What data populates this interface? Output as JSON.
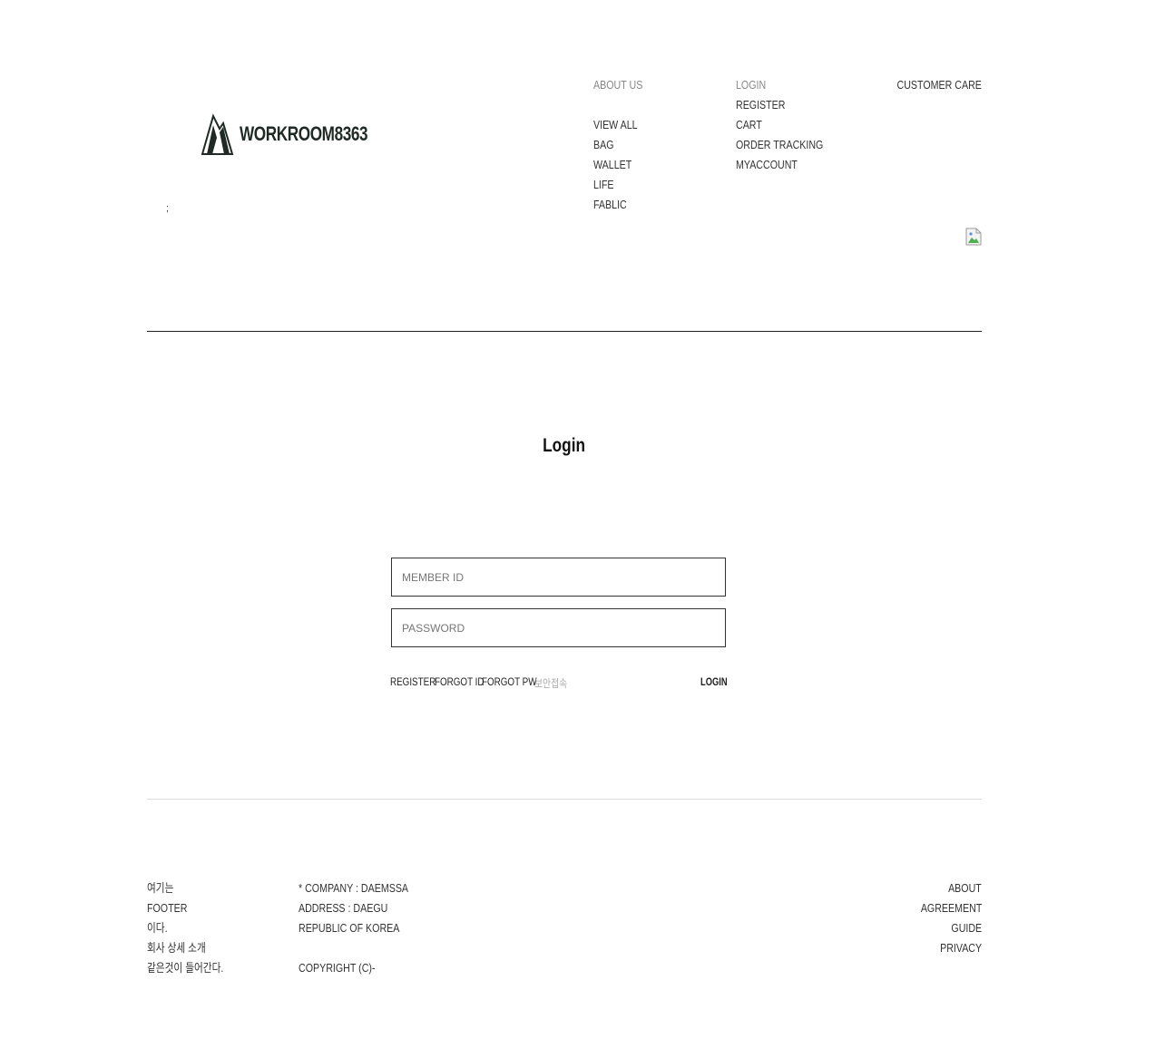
{
  "header": {
    "logo": {
      "text": "WORKROOM8363",
      "icon": "mountain-logo-icon"
    },
    "stray_mark": ";",
    "nav_about": {
      "heading": "ABOUT US",
      "items": [
        "VIEW ALL",
        "BAG",
        "WALLET",
        "LIFE",
        "FABLIC"
      ]
    },
    "nav_account": {
      "items": [
        "LOGIN",
        "REGISTER",
        "CART",
        "ORDER TRACKING",
        "MYACCOUNT"
      ]
    },
    "customer_care": "CUSTOMER CARE",
    "broken_image_icon": "broken-image-icon"
  },
  "login": {
    "title": "Login",
    "member_id_placeholder": "MEMBER ID",
    "password_placeholder": "PASSWORD",
    "links": {
      "register": "REGISTER",
      "forgot_id": "FORGOT ID",
      "forgot_pw": "FORGOT PW",
      "secure": "보안접속"
    },
    "login_button": "LOGIN"
  },
  "footer": {
    "left": [
      "여기는",
      "FOOTER",
      "이다.",
      "회사 상세 소개",
      "같은것이 들어간다."
    ],
    "company": {
      "line1": "* COMPANY : DAEMSSA",
      "line2": "ADDRESS : DAEGU",
      "line3": "REPUBLIC OF KOREA",
      "copyright": "COPYRIGHT (C)-"
    },
    "right": [
      "ABOUT",
      "AGREEMENT",
      "GUIDE",
      "PRIVACY"
    ]
  },
  "colors": {
    "text": "#222222",
    "muted_link": "#888888",
    "secure_link": "#aaaaaa",
    "logo": "#1f2a24"
  }
}
